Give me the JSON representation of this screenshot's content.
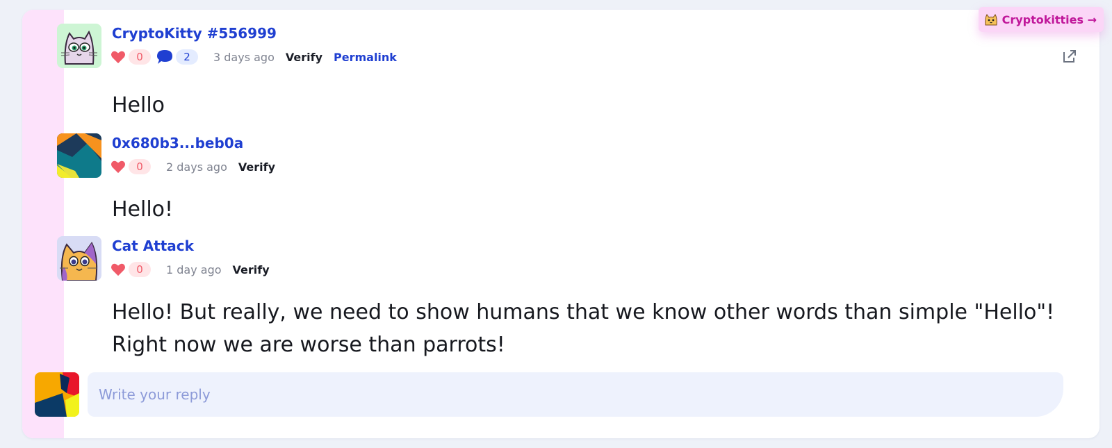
{
  "tag": {
    "label": "Cryptokitties →",
    "icon": "cat-face-icon"
  },
  "open_external_icon": "external-link-icon",
  "posts": [
    {
      "author": "CryptoKitty #556999",
      "avatar": "cryptokitty-avatar",
      "likes": "0",
      "replies": "2",
      "time": "3 days ago",
      "verify": "Verify",
      "permalink": "Permalink",
      "text": "Hello"
    },
    {
      "author": "0x680b3...beb0a",
      "avatar": "geometric-blockie-avatar",
      "likes": "0",
      "time": "2 days ago",
      "verify": "Verify",
      "text": "Hello!"
    },
    {
      "author": "Cat Attack",
      "avatar": "orange-cat-avatar",
      "likes": "0",
      "time": "1 day ago",
      "verify": "Verify",
      "text_lines": [
        "Hello! But really, we need to show humans that we know other words than simple \"Hello\"!",
        "Right now we are worse than parrots!"
      ]
    }
  ],
  "reply": {
    "placeholder": "Write your reply",
    "avatar": "user-blockie-avatar"
  },
  "colors": {
    "accent": "#1f3fd1",
    "stripe": "#fde2fb",
    "tag_text": "#c0179a",
    "like": "#f05a68"
  }
}
